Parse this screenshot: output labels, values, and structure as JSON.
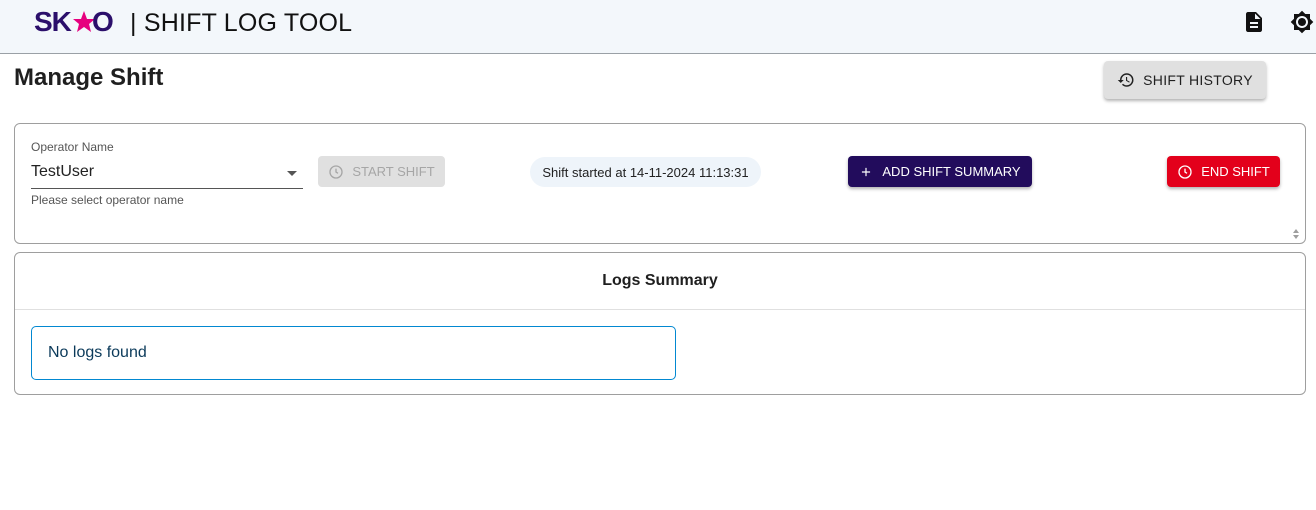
{
  "header": {
    "logo_text": "SKAO",
    "title": "| SHIFT LOG TOOL",
    "icons": [
      "document-icon",
      "theme-toggle-icon"
    ]
  },
  "page": {
    "title": "Manage Shift",
    "history_button": "SHIFT HISTORY"
  },
  "shift": {
    "operator_label": "Operator Name",
    "operator_value": "TestUser",
    "operator_helper": "Please select operator name",
    "start_button": "START SHIFT",
    "started_text": "Shift started at 14-11-2024 11:13:31",
    "add_summary_button": "ADD SHIFT SUMMARY",
    "end_button": "END SHIFT"
  },
  "logs": {
    "title": "Logs Summary",
    "empty_message": "No logs found"
  },
  "colors": {
    "brand_purple": "#220c5c",
    "logo_star": "#e6007e",
    "danger": "#e3001b",
    "info_border": "#0288d1",
    "header_bg": "#f3f7fb"
  }
}
